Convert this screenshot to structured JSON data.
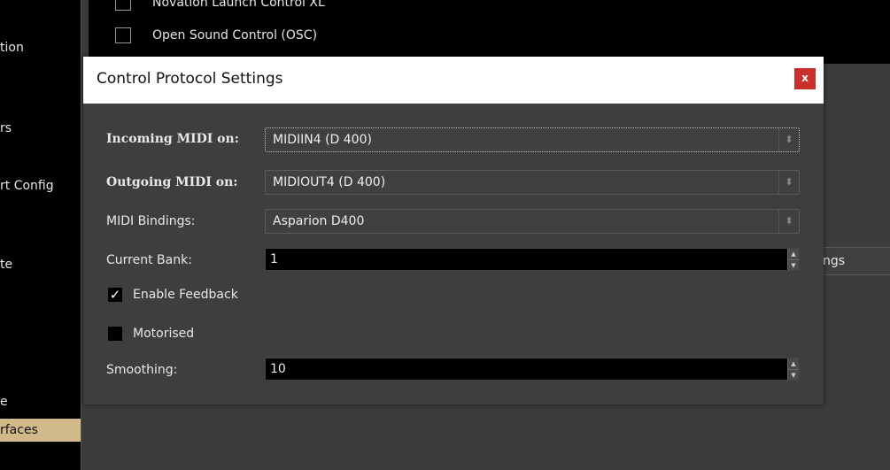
{
  "sidebar": {
    "items": [
      {
        "label": "tion"
      },
      {
        "label": "rs"
      },
      {
        "label": "rt Config"
      },
      {
        "label": "te"
      },
      {
        "label": "e"
      },
      {
        "label": "rfaces"
      }
    ]
  },
  "protocol_list": {
    "rows": [
      {
        "label": "Novation Launch Control XL"
      },
      {
        "label": "Open Sound Control (OSC)"
      }
    ]
  },
  "background_tab": {
    "label": "ngs"
  },
  "dialog": {
    "title": "Control Protocol Settings",
    "close_label": "x",
    "incoming": {
      "label": "Incoming MIDI on:",
      "value": "MIDIIN4 (D 400)"
    },
    "outgoing": {
      "label": "Outgoing MIDI on:",
      "value": "MIDIOUT4 (D 400)"
    },
    "bindings": {
      "label": "MIDI Bindings:",
      "value": "Asparion D400"
    },
    "bank": {
      "label": "Current Bank:",
      "value": "1"
    },
    "feedback": {
      "label": "Enable Feedback",
      "checked": true
    },
    "motorised": {
      "label": "Motorised",
      "checked": false
    },
    "smoothing": {
      "label": "Smoothing:",
      "value": "10"
    }
  }
}
